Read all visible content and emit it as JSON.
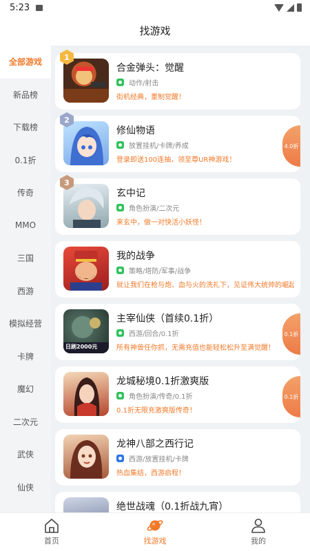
{
  "status_bar": {
    "time": "5:23"
  },
  "header": {
    "title": "找游戏"
  },
  "sidebar": {
    "items": [
      {
        "label": "全部游戏",
        "active": true
      },
      {
        "label": "新品榜"
      },
      {
        "label": "下载榜"
      },
      {
        "label": "0.1折"
      },
      {
        "label": "传奇"
      },
      {
        "label": "MMO"
      },
      {
        "label": "三国"
      },
      {
        "label": "西游"
      },
      {
        "label": "模拟经营"
      },
      {
        "label": "卡牌"
      },
      {
        "label": "魔幻"
      },
      {
        "label": "二次元"
      },
      {
        "label": "武侠"
      },
      {
        "label": "仙侠"
      }
    ]
  },
  "games": [
    {
      "rank": "1",
      "name": "合金弹头：觉醒",
      "tags": "动作/射击",
      "promo": "街机经典，重制觉醒！",
      "discount": "",
      "tag_color": "green"
    },
    {
      "rank": "2",
      "name": "修仙物语",
      "tags": "放置挂机/卡牌/养成",
      "promo": "登录即送100连抽，领至尊UR神游戏！",
      "discount": "4.0折",
      "tag_color": "green"
    },
    {
      "rank": "3",
      "name": "玄中记",
      "tags": "角色扮演/二次元",
      "promo": "来玄中，做一对快活小妖怪！",
      "discount": "",
      "tag_color": "green"
    },
    {
      "rank": "",
      "name": "我的战争",
      "tags": "策略/塔防/军事/战争",
      "promo": "就让我们在枪与炮、血与火的洗礼下，见证伟大统帅的崛起！",
      "discount": "",
      "tag_color": "green"
    },
    {
      "rank": "",
      "name": "主宰仙侠（首续0.1折）",
      "tags": "西游/回合/0.1折",
      "promo": "所有神兽任你抓，无需充值也能轻松松升至满觉醒！",
      "discount": "0.1折",
      "tag_color": "green"
    },
    {
      "rank": "",
      "name": "龙城秘境0.1折激爽版",
      "tags": "角色扮演/传奇/0.1折",
      "promo": "0.1折无限充激爽版传奇！",
      "discount": "0.1折",
      "tag_color": "green"
    },
    {
      "rank": "",
      "name": "龙神八部之西行记",
      "tags": "西游/放置挂机/卡牌",
      "promo": "热血集结，西游启程！",
      "discount": "",
      "tag_color": "blue"
    },
    {
      "rank": "",
      "name": "绝世战魂（0.1折战九宵）",
      "tags": "",
      "promo": "",
      "discount": "",
      "tag_color": "green"
    }
  ],
  "thumb_text": {
    "game5": "日刷2000元"
  },
  "bottom_nav": [
    {
      "label": "首页",
      "icon": "home-icon"
    },
    {
      "label": "找游戏",
      "icon": "game-planet-icon",
      "active": true
    },
    {
      "label": "我的",
      "icon": "user-icon"
    }
  ],
  "colors": {
    "accent": "#f07a2a",
    "sidebar_bg": "#f3f4f6",
    "content_bg": "#eef2f4"
  }
}
